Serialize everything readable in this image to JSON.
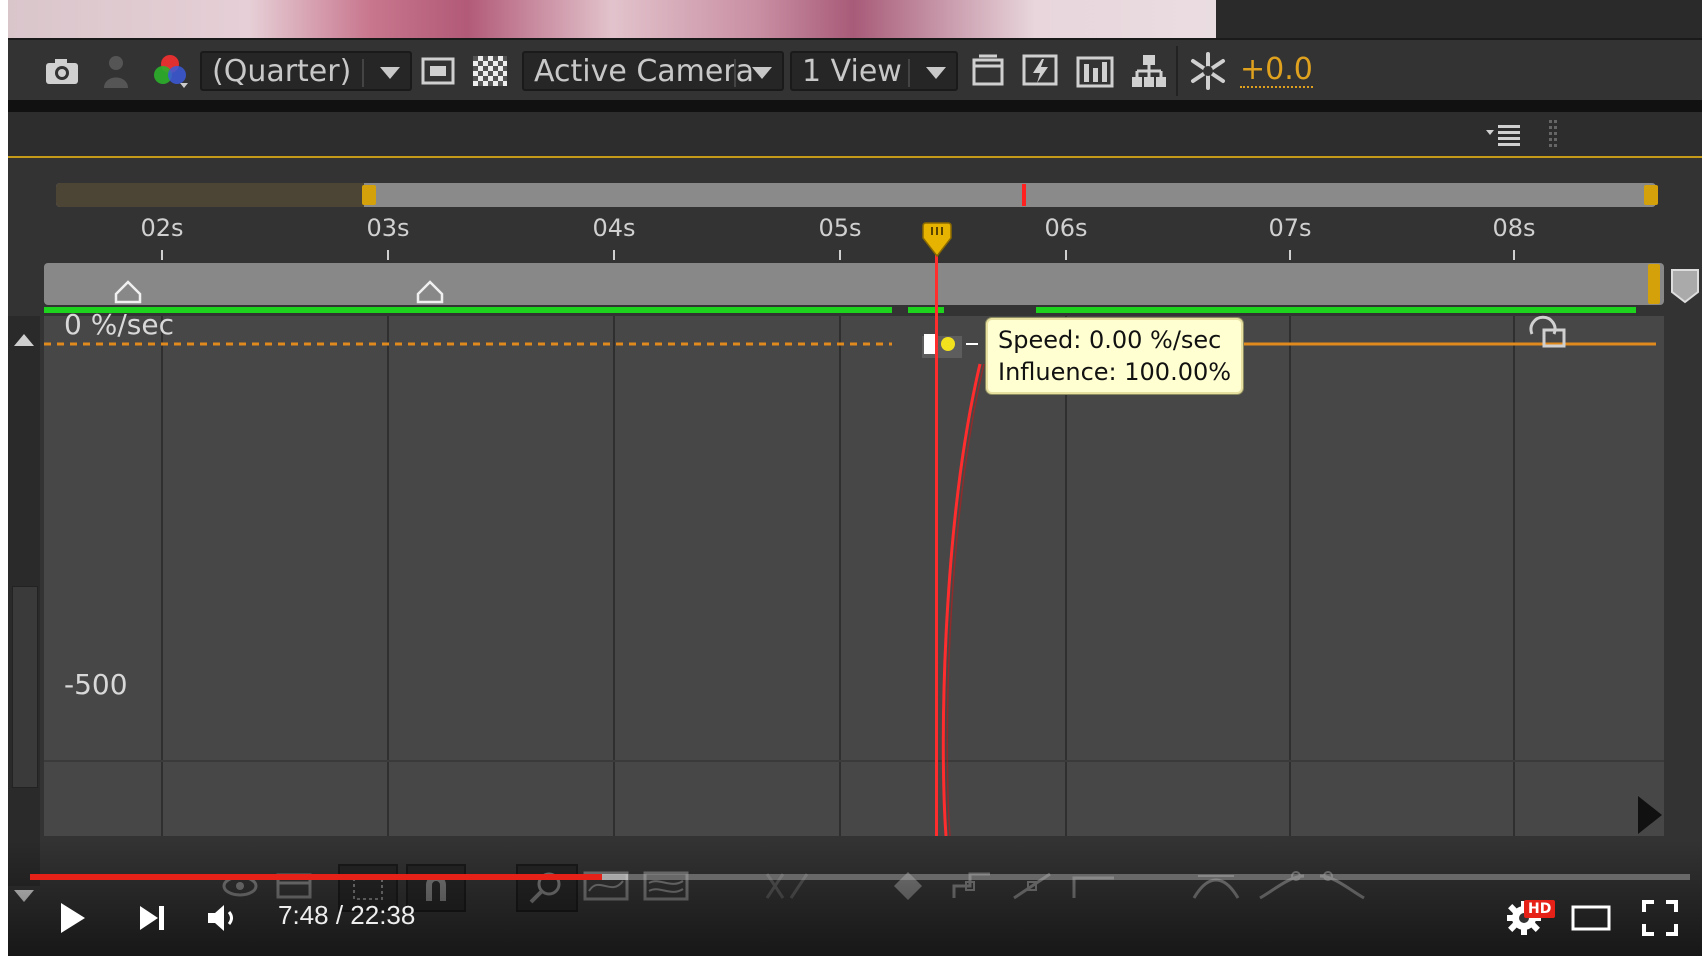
{
  "toolbar": {
    "resolution": "(Quarter)",
    "camera": "Active Camera",
    "views": "1 View",
    "exposure": "+0.0"
  },
  "timeline": {
    "ticks": [
      "02s",
      "03s",
      "04s",
      "05s",
      "06s",
      "07s",
      "08s"
    ],
    "current_time_marker": "5.1s"
  },
  "graph": {
    "top_label": "0 %/sec",
    "lower_label": "-500",
    "colors": {
      "speed_curve": "#ff2d2d",
      "baseline": "#e08a1e",
      "work_area": "#1ed31e",
      "accent": "#c49a18"
    }
  },
  "tooltip": {
    "speed": "Speed: 0.00 %/sec",
    "influence": "Influence: 100.00%"
  },
  "player": {
    "time_display": "7:48 / 22:38",
    "progress": 0.3447,
    "buffered": 0.36,
    "hd_badge": "HD"
  },
  "icons": {
    "toolbar": [
      "camera-icon",
      "user-icon",
      "channels-icon",
      "region-icon",
      "transparency-grid-icon",
      "grid-icon",
      "fast-preview-icon",
      "comp-flowchart-icon",
      "flowchart-icon",
      "exposure-icon"
    ],
    "player": [
      "play-icon",
      "next-icon",
      "volume-icon",
      "settings-icon",
      "theater-icon",
      "fullscreen-icon"
    ]
  }
}
